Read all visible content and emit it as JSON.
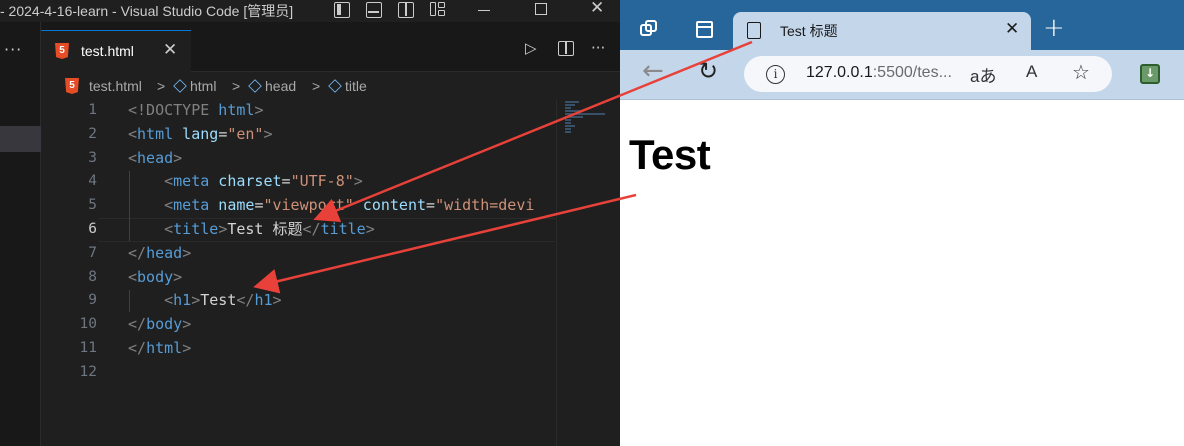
{
  "vscode": {
    "title": "- 2024-4-16-learn - Visual Studio Code [管理员]",
    "tab": {
      "label": "test.html",
      "close": "✕"
    },
    "more": "···",
    "breadcrumb": {
      "file": "test.html",
      "sep": ">",
      "items": [
        "html",
        "head",
        "title"
      ]
    },
    "line_numbers": [
      "1",
      "2",
      "3",
      "4",
      "5",
      "6",
      "7",
      "8",
      "9",
      "10",
      "11",
      "12"
    ],
    "active_line": "6",
    "code": {
      "l1": {
        "open": "<!DOCTYPE",
        "kw": " html",
        "close": ">"
      },
      "l2": {
        "lt": "<",
        "tag": "html",
        "attr": " lang",
        "eq": "=",
        "val": "\"en\"",
        "gt": ">"
      },
      "l3": {
        "lt": "<",
        "tag": "head",
        "gt": ">"
      },
      "l4": {
        "lt": "<",
        "tag": "meta",
        "attr": " charset",
        "eq": "=",
        "val": "\"UTF-8\"",
        "gt": ">"
      },
      "l5": {
        "lt": "<",
        "tag": "meta",
        "attr1": " name",
        "eq1": "=",
        "val1": "\"viewport\"",
        "attr2": " content",
        "eq2": "=",
        "val2": "\"width=devi"
      },
      "l6": {
        "lt": "<",
        "tag": "title",
        "gt": ">",
        "text": "Test 标题",
        "lt2": "</",
        "tag2": "title",
        "gt2": ">"
      },
      "l7": {
        "lt": "</",
        "tag": "head",
        "gt": ">"
      },
      "l8": {
        "lt": "<",
        "tag": "body",
        "gt": ">"
      },
      "l9": {
        "lt": "<",
        "tag": "h1",
        "gt": ">",
        "text": "Test",
        "lt2": "</",
        "tag2": "h1",
        "gt2": ">"
      },
      "l10": {
        "lt": "</",
        "tag": "body",
        "gt": ">"
      },
      "l11": {
        "lt": "</",
        "tag": "html",
        "gt": ">"
      }
    }
  },
  "browser": {
    "tab_title": "Test 标题",
    "tab_close": "✕",
    "new_tab": "+",
    "url_host": "127.0.0.1",
    "url_rest": ":5500/tes...",
    "read_aloud": "A",
    "translate": "aあ",
    "page_h1": "Test"
  },
  "annotation_color": "#e8413a"
}
